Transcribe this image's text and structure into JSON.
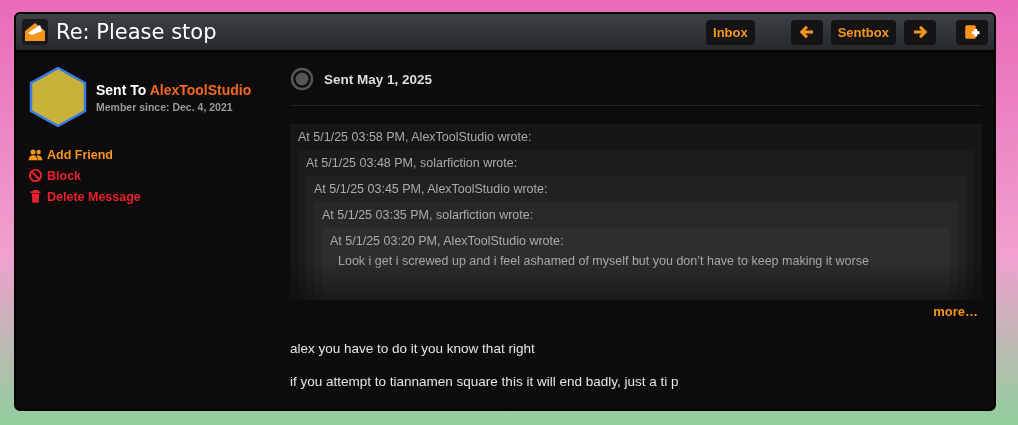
{
  "window": {
    "title": "Re: Please stop"
  },
  "toolbar": [
    {
      "kind": "text",
      "label": "Inbox"
    },
    {
      "kind": "prev"
    },
    {
      "kind": "text",
      "label": "Sentbox"
    },
    {
      "kind": "next"
    },
    {
      "kind": "compose"
    }
  ],
  "recipient": {
    "prefix": "Sent To",
    "name": "AlexToolStudio",
    "member_since": "Member since: Dec. 4, 2021"
  },
  "actions": [
    {
      "kind": "friend",
      "label": "Add Friend"
    },
    {
      "kind": "block",
      "label": "Block"
    },
    {
      "kind": "delete",
      "label": "Delete Message"
    }
  ],
  "message": {
    "sent": "Sent May 1, 2025",
    "quote": {
      "header": "At 5/1/25 03:58 PM, AlexToolStudio wrote:",
      "children": [
        {
          "header": "At 5/1/25 03:48 PM, solarfiction wrote:",
          "children": [
            {
              "header": "At 5/1/25 03:45 PM, AlexToolStudio wrote:",
              "children": [
                {
                  "header": "At 5/1/25 03:35 PM, solarfiction wrote:",
                  "children": [
                    {
                      "header": "At 5/1/25 03:20 PM, AlexToolStudio wrote:",
                      "lines": [
                        "Look i get i screwed up and i feel ashamed of myself but you don’t have to keep making it worse"
                      ]
                    }
                  ]
                }
              ]
            }
          ]
        }
      ]
    },
    "more": "more…",
    "paragraphs": [
      "alex you have to do it you know that right",
      "if you attempt to tiannamen square this it will end badly, just a ti p"
    ]
  }
}
